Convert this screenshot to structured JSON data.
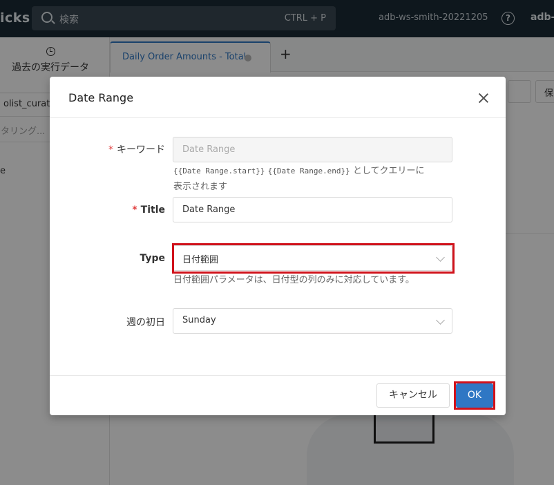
{
  "topbar": {
    "brand": "icks",
    "search_placeholder": "検索",
    "search_shortcut": "CTRL + P",
    "workspace": "adb-ws-smith-20221205",
    "user": "adb-"
  },
  "left_pane": {
    "history_label": "過去の実行データ",
    "schema_value": "olist_curate",
    "filter_placeholder": "タリング...",
    "tree_fragment": "e"
  },
  "tabs": [
    {
      "label": "Daily Order Amounts - Total"
    }
  ],
  "toolbar": {
    "save_label": "保"
  },
  "modal": {
    "title": "Date Range",
    "keyword": {
      "label": "キーワード",
      "value": "Date Range",
      "hint_code_start": "{{Date Range.start}}",
      "hint_code_end": "{{Date Range.end}}",
      "hint_suffix": " としてクエリーに",
      "hint_line2": "表示されます"
    },
    "title_field": {
      "label": "Title",
      "value": "Date Range"
    },
    "type_field": {
      "label": "Type",
      "value": "日付範囲",
      "hint": "日付範囲パラメータは、日付型の列のみに対応しています。"
    },
    "first_day": {
      "label": "週の初日",
      "value": "Sunday"
    },
    "cancel_label": "キャンセル",
    "ok_label": "OK"
  },
  "colors": {
    "accent": "#2f77c4",
    "highlight": "#d0121b",
    "topbar": "#1b2a35"
  }
}
